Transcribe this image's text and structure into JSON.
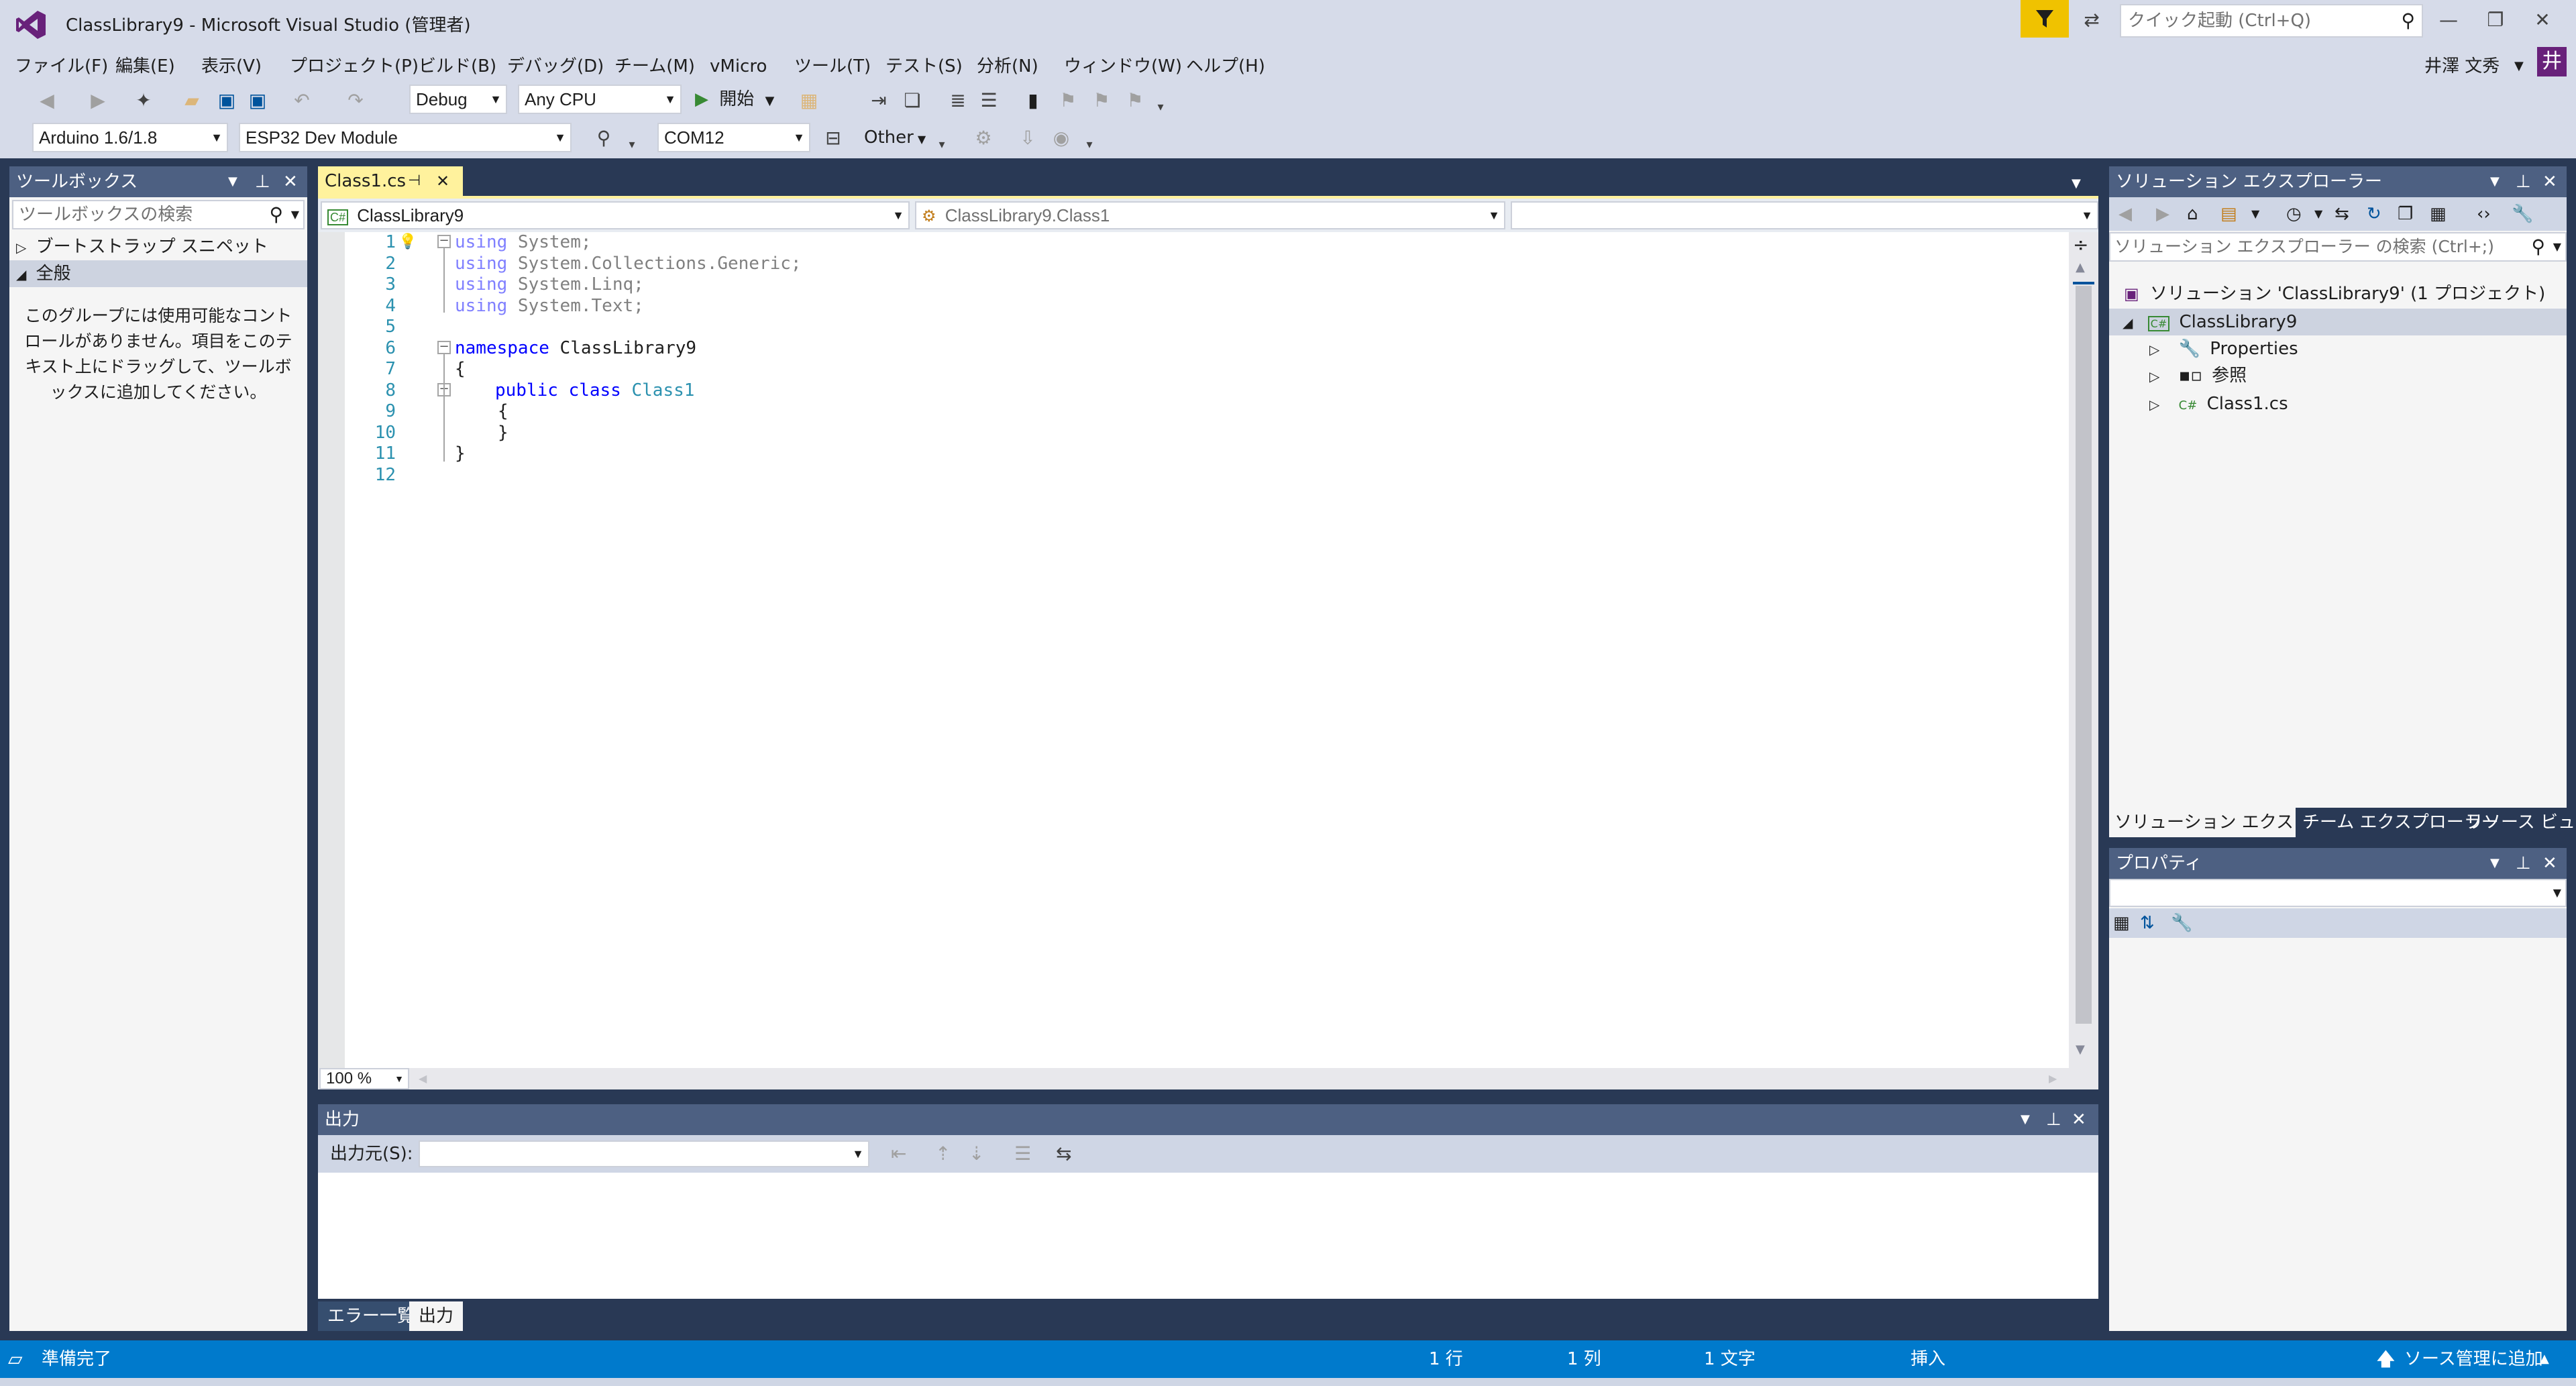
{
  "window": {
    "title": "ClassLibrary9 - Microsoft Visual Studio  (管理者)",
    "quick_launch_placeholder": "クイック起動 (Ctrl+Q)",
    "user_name": "井澤 文秀",
    "user_initial": "井"
  },
  "menu": [
    "ファイル(F)",
    "編集(E)",
    "表示(V)",
    "プロジェクト(P)",
    "ビルド(B)",
    "デバッグ(D)",
    "チーム(M)",
    "vMicro",
    "ツール(T)",
    "テスト(S)",
    "分析(N)",
    "ウィンドウ(W)",
    "ヘルプ(H)"
  ],
  "toolbar": {
    "config": "Debug",
    "platform": "Any CPU",
    "start_label": "開始",
    "arduino_version": "Arduino 1.6/1.8",
    "board": "ESP32 Dev Module",
    "port": "COM12",
    "other_label": "Other"
  },
  "toolbox": {
    "title": "ツールボックス",
    "search_placeholder": "ツールボックスの検索",
    "groups": [
      "ブートストラップ スニペット",
      "全般"
    ],
    "empty_message": "このグループには使用可能なコントロールがありません。項目をこのテキスト上にドラッグして、ツールボックスに追加してください。"
  },
  "editor": {
    "tab_label": "Class1.cs",
    "nav_project": "ClassLibrary9",
    "nav_class": "ClassLibrary9.Class1",
    "nav_member": "",
    "zoom": "100 %",
    "line_numbers": [
      "1",
      "2",
      "3",
      "4",
      "5",
      "6",
      "7",
      "8",
      "9",
      "10",
      "11",
      "12"
    ],
    "lines": [
      {
        "kw": "using",
        "rest": " System;"
      },
      {
        "kw": "using",
        "rest": " System.Collections.Generic;"
      },
      {
        "kw": "using",
        "rest": " System.Linq;"
      },
      {
        "kw": "using",
        "rest": " System.Text;"
      },
      {
        "kw": "",
        "rest": ""
      },
      {
        "kw": "namespace",
        "rest": " ClassLibrary9"
      },
      {
        "kw": "",
        "rest": "{"
      },
      {
        "kw": "public class",
        "rest": "Class1"
      },
      {
        "kw": "",
        "rest": "{"
      },
      {
        "kw": "",
        "rest": "}"
      },
      {
        "kw": "",
        "rest": "}"
      },
      {
        "kw": "",
        "rest": ""
      }
    ]
  },
  "output": {
    "title": "出力",
    "source_label": "出力元(S):",
    "source_value": ""
  },
  "bottom_tabs": [
    "エラー一覧",
    "出力"
  ],
  "solution_explorer": {
    "title": "ソリューション エクスプローラー",
    "search_placeholder": "ソリューション エクスプローラー の検索 (Ctrl+;)",
    "solution_label": "ソリューション 'ClassLibrary9' (1 プロジェクト)",
    "project": "ClassLibrary9",
    "children": [
      "Properties",
      "参照",
      "Class1.cs"
    ],
    "tabs": [
      "ソリューション エクスプ...",
      "チーム エクスプローラー",
      "リソース ビュー"
    ]
  },
  "properties": {
    "title": "プロパティ"
  },
  "status": {
    "ready": "準備完了",
    "line": "1 行",
    "col": "1 列",
    "chars": "1 文字",
    "mode": "挿入",
    "source_control": "ソース管理に追加"
  },
  "colors": {
    "accent": "#007acc",
    "panel_header": "#4d6082",
    "active_tab": "#fff29d",
    "notification": "#f0c200",
    "avatar": "#68217a"
  }
}
